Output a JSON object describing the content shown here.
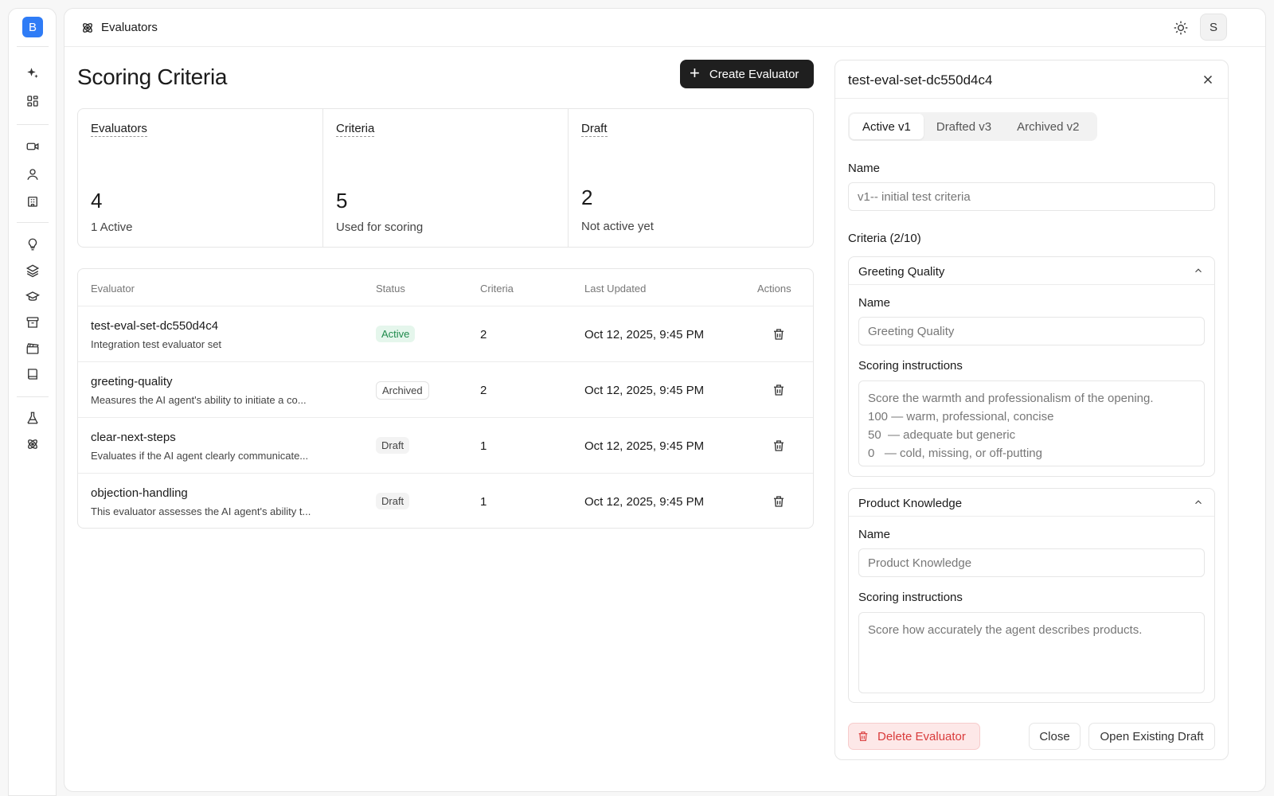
{
  "app": {
    "logo_letter": "B",
    "accent": "#2f7cf6"
  },
  "sidebar": {
    "items": [
      {
        "icon": "sparkles-icon"
      },
      {
        "icon": "dashboard-icon"
      },
      {
        "icon": "video-icon"
      },
      {
        "icon": "user-icon"
      },
      {
        "icon": "building-icon"
      },
      {
        "icon": "lightbulb-icon"
      },
      {
        "icon": "layers-icon"
      },
      {
        "icon": "graduation-cap-icon"
      },
      {
        "icon": "archive-icon"
      },
      {
        "icon": "clapperboard-icon"
      },
      {
        "icon": "book-icon"
      },
      {
        "icon": "flask-icon"
      },
      {
        "icon": "evaluators-icon"
      }
    ]
  },
  "topbar": {
    "page_name": "Evaluators",
    "avatar_letter": "S"
  },
  "page": {
    "title": "Scoring Criteria",
    "create_label": "Create Evaluator"
  },
  "stats": [
    {
      "label": "Evaluators",
      "value": "4",
      "sub": "1 Active"
    },
    {
      "label": "Criteria",
      "value": "5",
      "sub": "Used for scoring"
    },
    {
      "label": "Draft",
      "value": "2",
      "sub": "Not active yet"
    }
  ],
  "table": {
    "headers": {
      "evaluator": "Evaluator",
      "status": "Status",
      "criteria": "Criteria",
      "updated": "Last Updated",
      "actions": "Actions"
    },
    "rows": [
      {
        "name": "test-eval-set-dc550d4c4",
        "desc": "Integration test evaluator set",
        "status": "Active",
        "criteria": "2",
        "updated": "Oct 12, 2025, 9:45 PM"
      },
      {
        "name": "greeting-quality",
        "desc": "Measures the AI agent's ability to initiate a co...",
        "status": "Archived",
        "criteria": "2",
        "updated": "Oct 12, 2025, 9:45 PM"
      },
      {
        "name": "clear-next-steps",
        "desc": "Evaluates if the AI agent clearly communicate...",
        "status": "Draft",
        "criteria": "1",
        "updated": "Oct 12, 2025, 9:45 PM"
      },
      {
        "name": "objection-handling",
        "desc": "This evaluator assesses the AI agent's ability t...",
        "status": "Draft",
        "criteria": "1",
        "updated": "Oct 12, 2025, 9:45 PM"
      }
    ]
  },
  "panel": {
    "title": "test-eval-set-dc550d4c4",
    "tabs": [
      "Active v1",
      "Drafted v3",
      "Archived v2"
    ],
    "name_label": "Name",
    "name_value": "v1-- initial test criteria",
    "criteria_label": "Criteria (2/10)",
    "criteria": [
      {
        "title": "Greeting Quality",
        "name_label": "Name",
        "name_value": "Greeting Quality",
        "instructions_label": "Scoring instructions",
        "instructions": "Score the warmth and professionalism of the opening.\n100 — warm, professional, concise\n50  — adequate but generic\n0   — cold, missing, or off-putting"
      },
      {
        "title": "Product Knowledge",
        "name_label": "Name",
        "name_value": "Product Knowledge",
        "instructions_label": "Scoring instructions",
        "instructions": "Score how accurately the agent describes products."
      }
    ],
    "delete_label": "Delete Evaluator",
    "close_label": "Close",
    "open_draft_label": "Open Existing Draft"
  }
}
